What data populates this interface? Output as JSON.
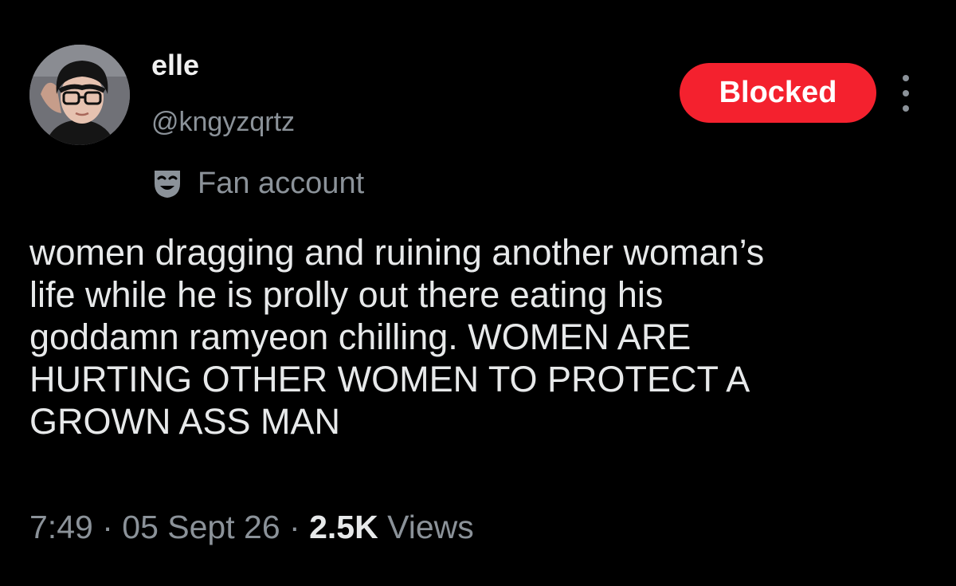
{
  "author": {
    "display_name": "elle",
    "handle": "@kngyzqrtz",
    "avatar_icon": "profile-photo",
    "label": {
      "icon": "theater-mask-icon",
      "text": "Fan account"
    }
  },
  "actions": {
    "blocked_label": "Blocked",
    "blocked_color": "#f4212e",
    "more_icon": "more-vertical-icon"
  },
  "tweet": {
    "text": "women dragging and ruining another woman’s\nlife while he is prolly out there eating his\ngoddamn ramyeon chilling. WOMEN ARE\nHURTING OTHER WOMEN TO PROTECT A\nGROWN ASS MAN"
  },
  "meta": {
    "time": "7:49",
    "separator": "·",
    "date": "05 Sept 26",
    "views_count": "2.5K",
    "views_label": "Views"
  },
  "colors": {
    "background": "#000000",
    "primary_text": "#e7e9ea",
    "secondary_text": "#8b9299"
  }
}
